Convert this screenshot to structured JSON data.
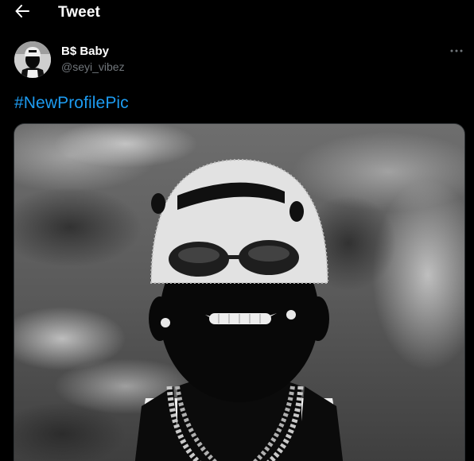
{
  "header": {
    "title": "Tweet",
    "back_icon": "arrow-left-icon"
  },
  "tweet": {
    "author": {
      "display_name": "B$ Baby",
      "handle": "@seyi_vibez",
      "avatar_alt": "avatar"
    },
    "more_icon": "more-horizontal-icon",
    "text": "#NewProfilePic",
    "media": {
      "description_icon": "photo"
    }
  },
  "colors": {
    "background": "#000000",
    "hashtag": "#1d9bf0",
    "handle": "#71767b"
  }
}
